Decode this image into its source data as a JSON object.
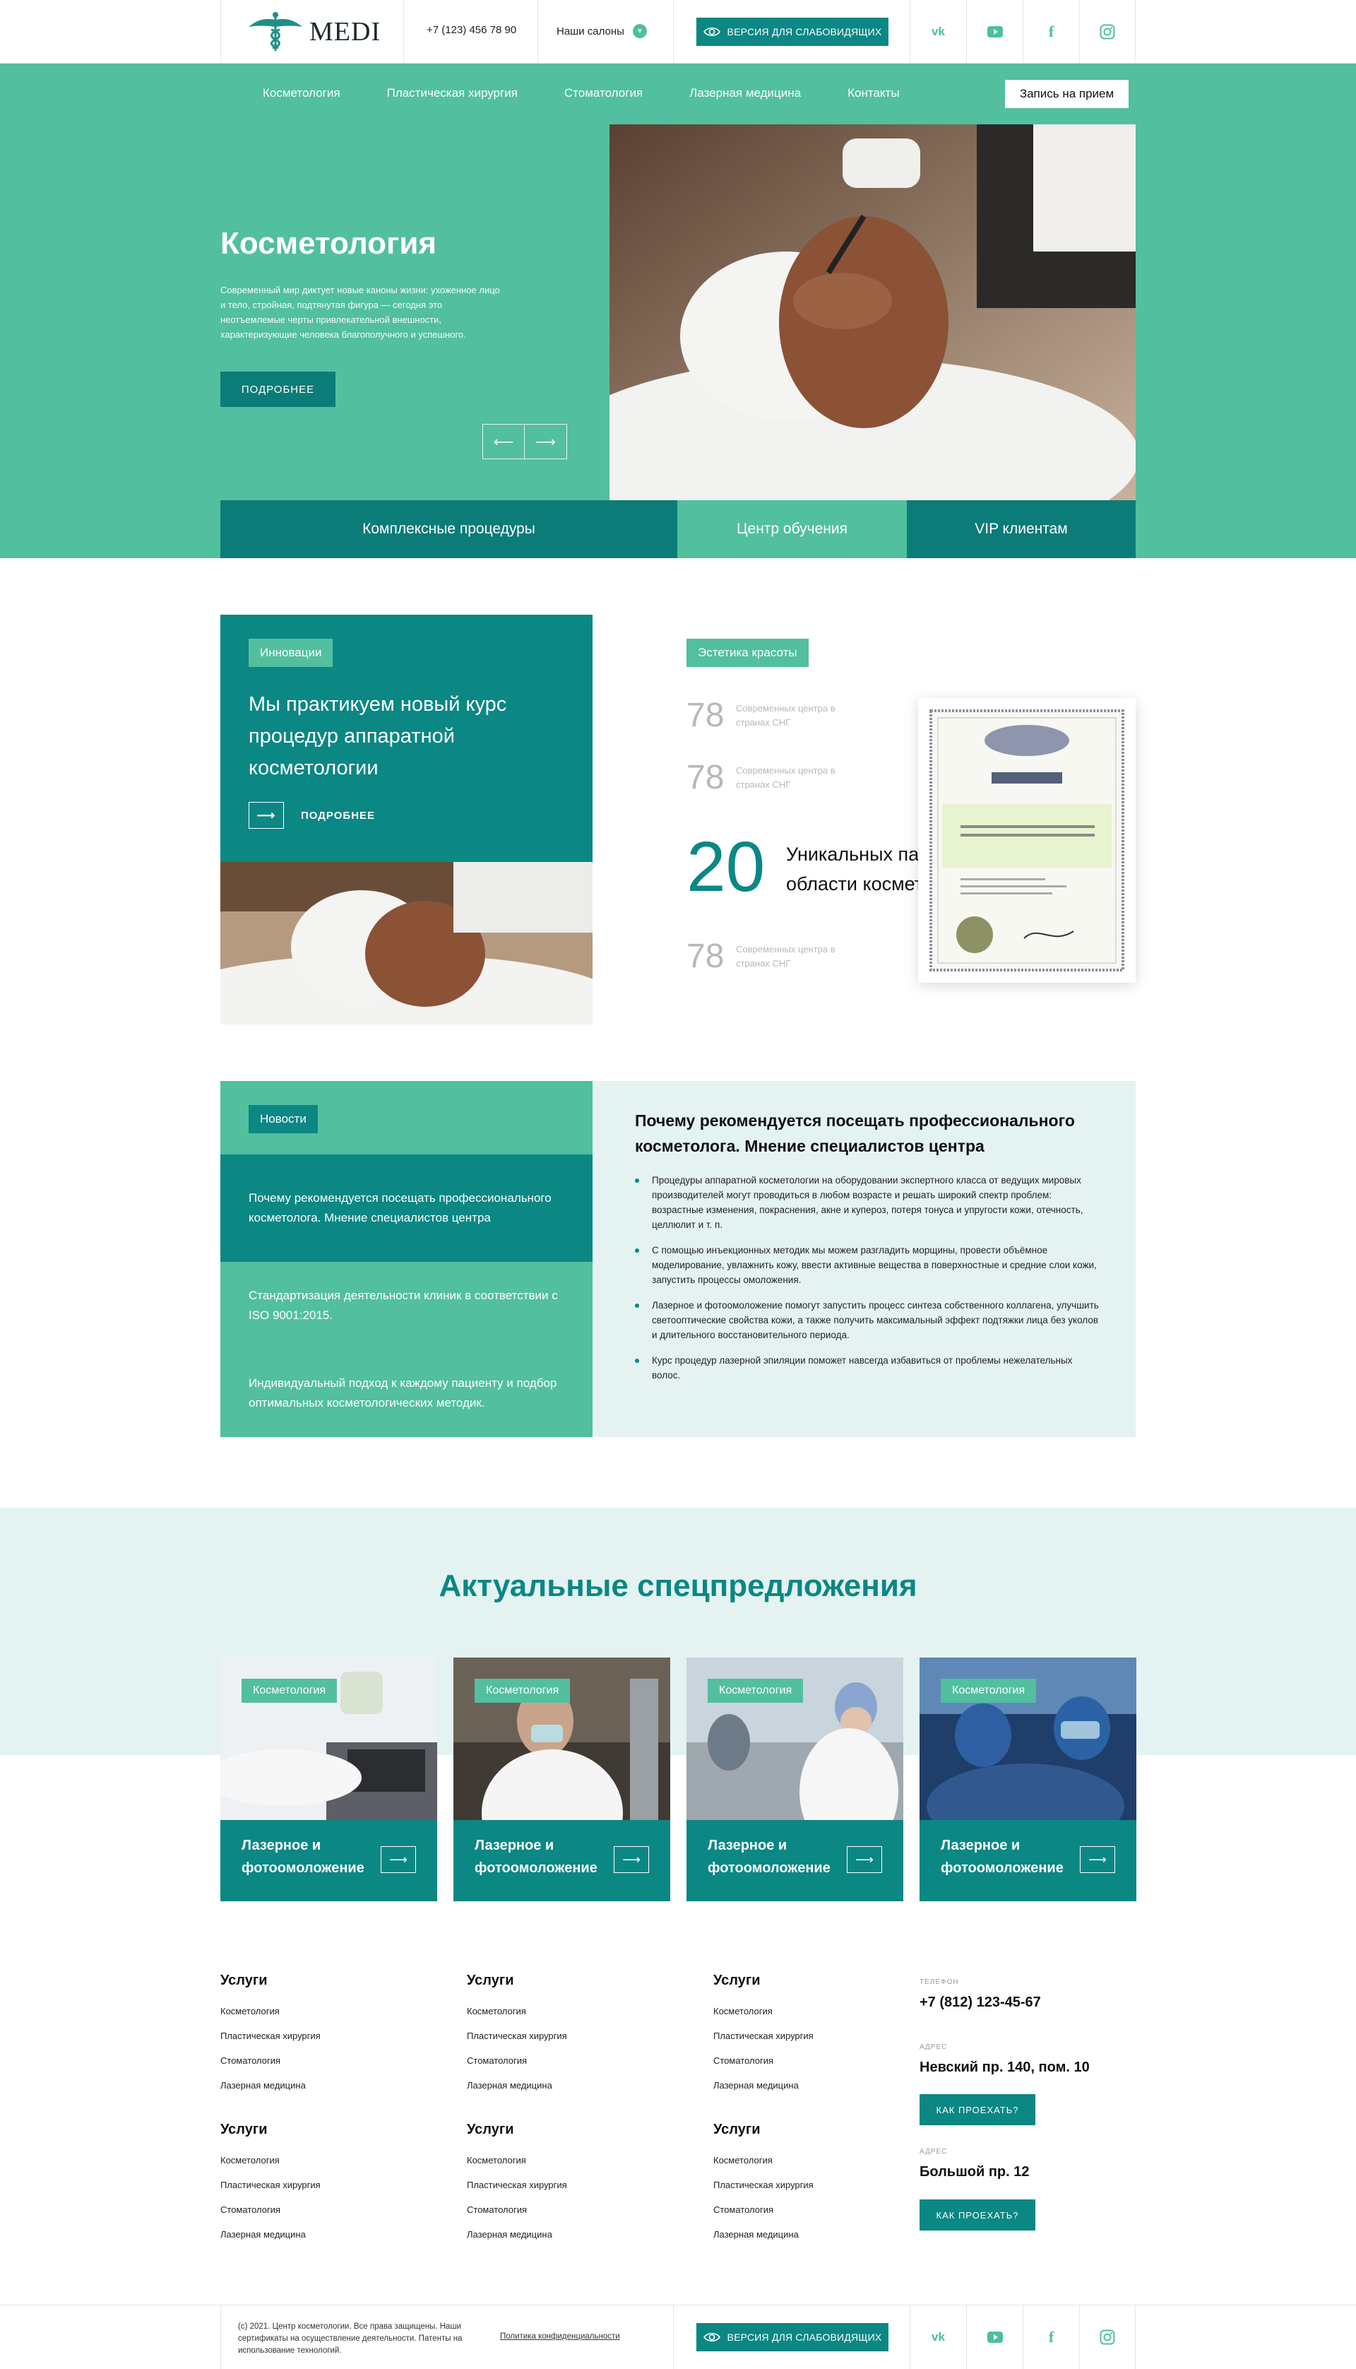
{
  "header": {
    "logo_text": "MEDI",
    "phone": "+7 (123) 456 78 90",
    "salons_label": "Наши салоны",
    "vision_button": "ВЕРСИЯ ДЛЯ СЛАБОВИДЯЩИХ",
    "socials": [
      "vk-icon",
      "youtube-icon",
      "facebook-icon",
      "instagram-icon"
    ]
  },
  "nav": {
    "items": [
      "Косметология",
      "Пластическая хирургия",
      "Стоматология",
      "Лазерная медицина",
      "Контакты"
    ],
    "record_button": "Запись на прием"
  },
  "hero": {
    "title": "Косметология",
    "text": "Современный мир диктует новые каноны жизни: ухоженное лицо и тело, стройная, подтянутая фигура — сегодня это неотъемлемые черты привлекательной внешности, характеризующие человека благополучного и успешного.",
    "more_button": "ПОДРОБНЕЕ",
    "prev_arrow": "⟵",
    "next_arrow": "⟶",
    "tabs": [
      "Комплексные процедуры",
      "Центр обучения",
      "VIP клиентам"
    ]
  },
  "innovation": {
    "badge": "Инновации",
    "title": "Мы практикуем новый курс процедур аппаратной косметологии",
    "more": "ПОДРОБНЕЕ"
  },
  "aesthetics": {
    "badge": "Эстетика красоты",
    "stats": [
      {
        "num": "78",
        "label": "Современных центра в странах СНГ"
      },
      {
        "num": "78",
        "label": "Современных центра в странах СНГ"
      },
      {
        "num": "78",
        "label": "Современных центра в странах СНГ"
      }
    ],
    "big_num": "20",
    "big_label": "Уникальных патентов в области косметологии"
  },
  "news": {
    "badge": "Новости",
    "items": [
      "Почему рекомендуется посещать профессионального косметолога. Мнение специалистов центра",
      "Стандартизация деятельности клиник в соответствии с ISO 9001:2015.",
      "Индивидуальный подход к каждому пациенту и подбор оптимальных косметологических методик."
    ],
    "article_title": "Почему рекомендуется посещать профессионального косметолога. Мнение специалистов центра",
    "article_points": [
      "Процедуры аппаратной косметологии на оборудовании экспертного класса от ведущих мировых производителей могут проводиться в любом возрасте и решать широкий спектр проблем: возрастные изменения, покраснения, акне и купероз, потеря тонуса и упругости кожи, отечность, целлюлит и т. п.",
      "С помощью инъекционных методик мы можем разгладить морщины, провести объёмное моделирование, увлажнить кожу, ввести активные вещества в поверхностные и средние слои кожи, запустить процессы омоложения.",
      "Лазерное и фотоомоложение помогут запустить процесс синтеза собственного коллагена, улучшить светооптические свойства кожи, а также получить максимальный эффект подтяжки лица без уколов и длительного восстановительного периода.",
      "Курс процедур лазерной эпиляции поможет навсегда избавиться от проблемы нежелательных волос."
    ]
  },
  "offers": {
    "title": "Актуальные спецпредложения",
    "cards": [
      {
        "tag": "Косметология",
        "title": "Лазерное и фотоомоложение"
      },
      {
        "tag": "Косметология",
        "title": "Лазерное и фотоомоложение"
      },
      {
        "tag": "Косметология",
        "title": "Лазерное и фотоомоложение"
      },
      {
        "tag": "Косметология",
        "title": "Лазерное и фотоомоложение"
      }
    ]
  },
  "footer": {
    "columns": [
      {
        "title": "Услуги",
        "links": [
          "Косметология",
          "Пластическая хирургия",
          "Стоматология",
          "Лазерная медицина"
        ]
      },
      {
        "title": "Услуги",
        "links": [
          "Косметология",
          "Пластическая хирургия",
          "Стоматология",
          "Лазерная медицина"
        ]
      },
      {
        "title": "Услуги",
        "links": [
          "Косметология",
          "Пластическая хирургия",
          "Стоматология",
          "Лазерная медицина"
        ]
      },
      {
        "title": "Услуги",
        "links": [
          "Косметология",
          "Пластическая хирургия",
          "Стоматология",
          "Лазерная медицина"
        ]
      },
      {
        "title": "Услуги",
        "links": [
          "Косметология",
          "Пластическая хирургия",
          "Стоматология",
          "Лазерная медицина"
        ]
      },
      {
        "title": "Услуги",
        "links": [
          "Косметология",
          "Пластическая хирургия",
          "Стоматология",
          "Лазерная медицина"
        ]
      }
    ],
    "phone_label": "ТЕЛЕФОН",
    "phone": "+7 (812) 123-45-67",
    "address_label_1": "АДРЕС",
    "address_1": "Невский пр. 140, пом. 10",
    "route_button_1": "КАК ПРОЕХАТЬ?",
    "address_label_2": "АДРЕС",
    "address_2": "Большой пр. 12",
    "route_button_2": "КАК ПРОЕХАТЬ?",
    "copyright": "(c) 2021. Центр косметологии. Все права защищены. Наши сертификаты на осуществление деятельности. Патенты на использование технологий.",
    "privacy": "Политика конфиденциальности",
    "vision_button": "ВЕРСИЯ ДЛЯ СЛАБОВИДЯЩИХ"
  },
  "colors": {
    "teal_dark": "#0b8784",
    "teal_light": "#52bf9f",
    "mint_bg": "#e4f3f1"
  }
}
